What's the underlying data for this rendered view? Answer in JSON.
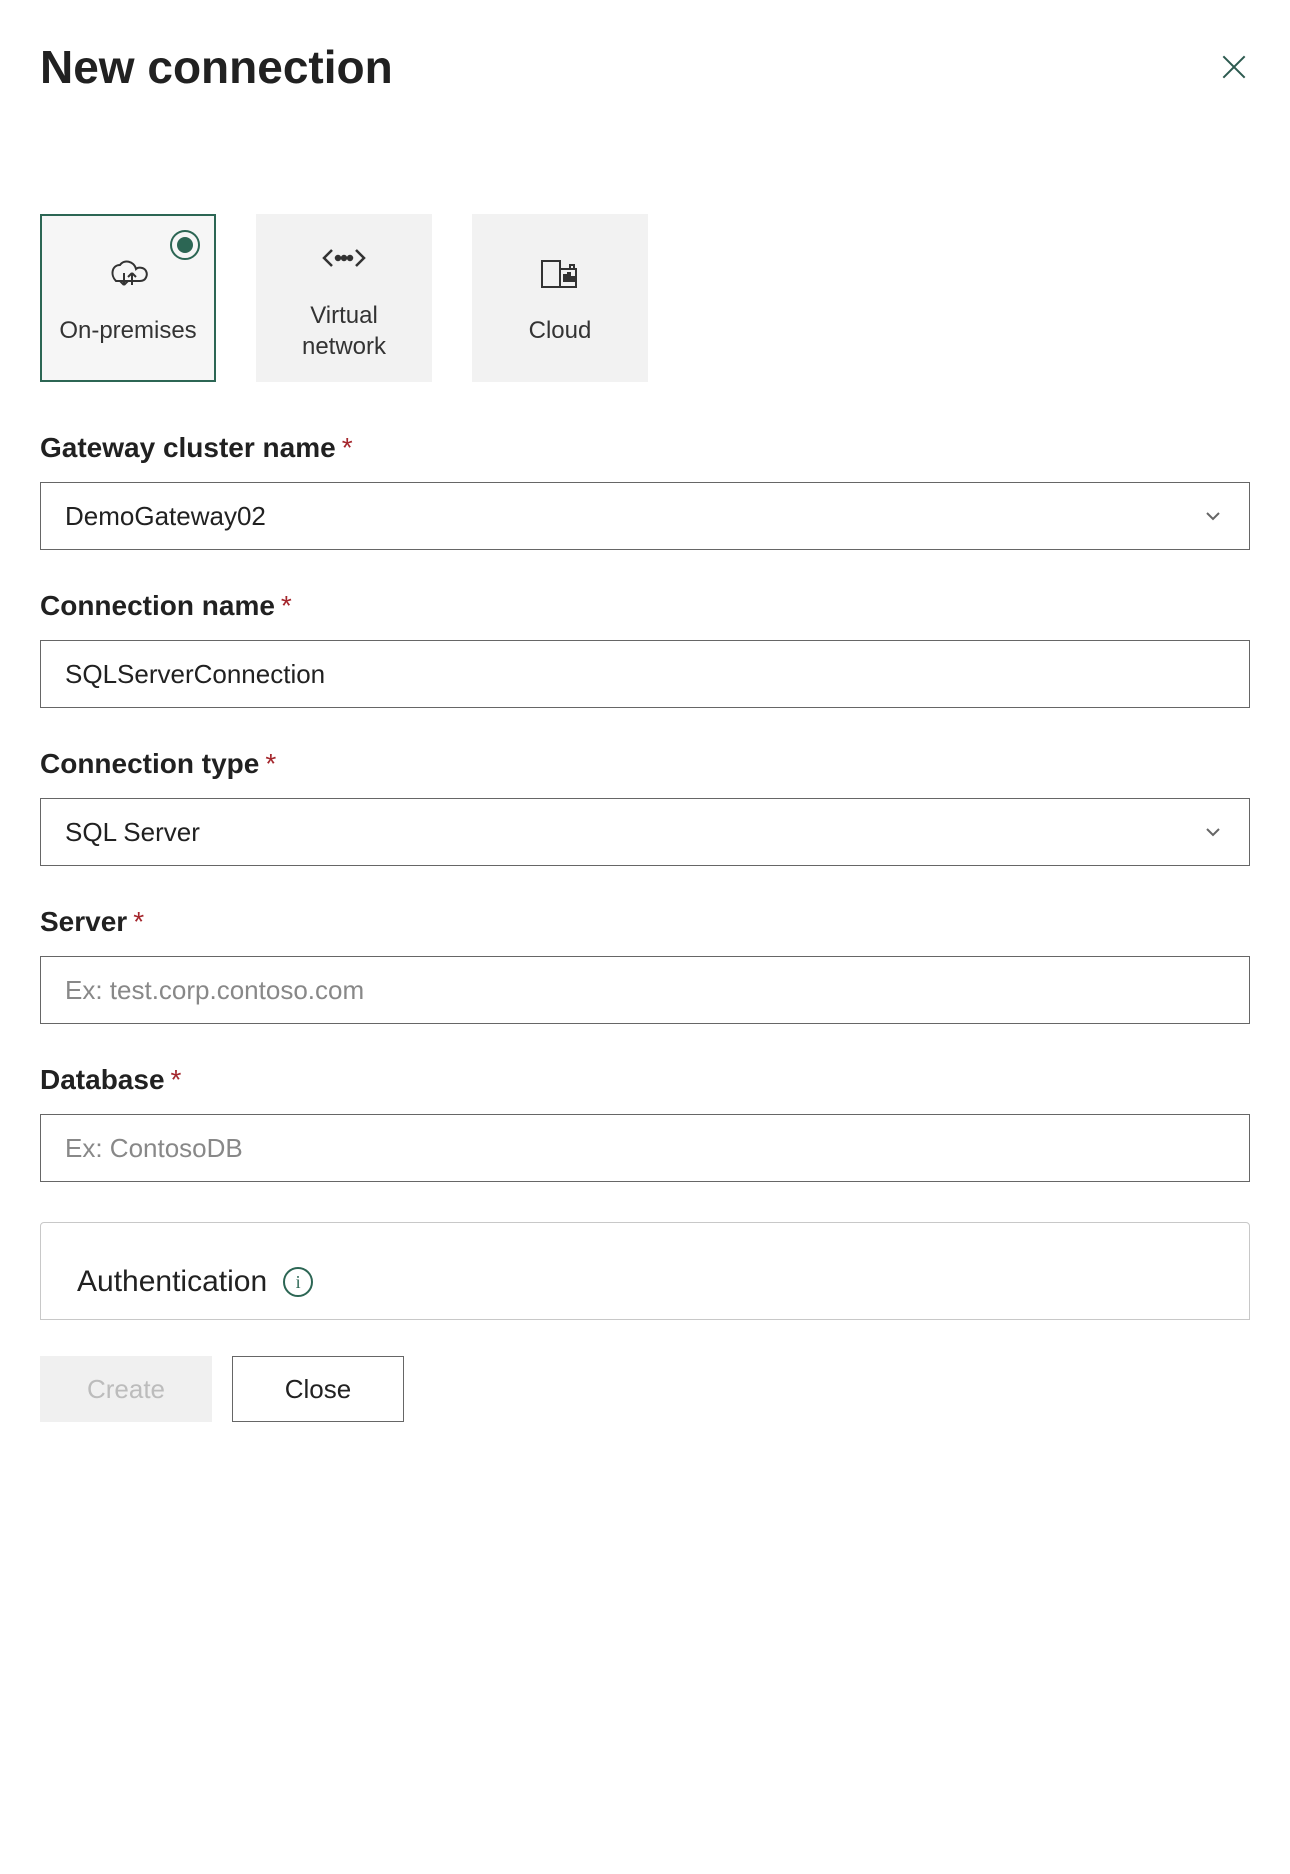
{
  "header": {
    "title": "New connection"
  },
  "tiles": {
    "on_premises": "On-premises",
    "virtual_network": "Virtual network",
    "cloud": "Cloud"
  },
  "fields": {
    "gateway_cluster": {
      "label": "Gateway cluster name",
      "value": "DemoGateway02"
    },
    "connection_name": {
      "label": "Connection name",
      "value": "SQLServerConnection"
    },
    "connection_type": {
      "label": "Connection type",
      "value": "SQL Server"
    },
    "server": {
      "label": "Server",
      "placeholder": "Ex: test.corp.contoso.com",
      "value": ""
    },
    "database": {
      "label": "Database",
      "placeholder": "Ex: ContosoDB",
      "value": ""
    }
  },
  "auth": {
    "title": "Authentication"
  },
  "footer": {
    "create": "Create",
    "close": "Close"
  },
  "required_mark": "*"
}
